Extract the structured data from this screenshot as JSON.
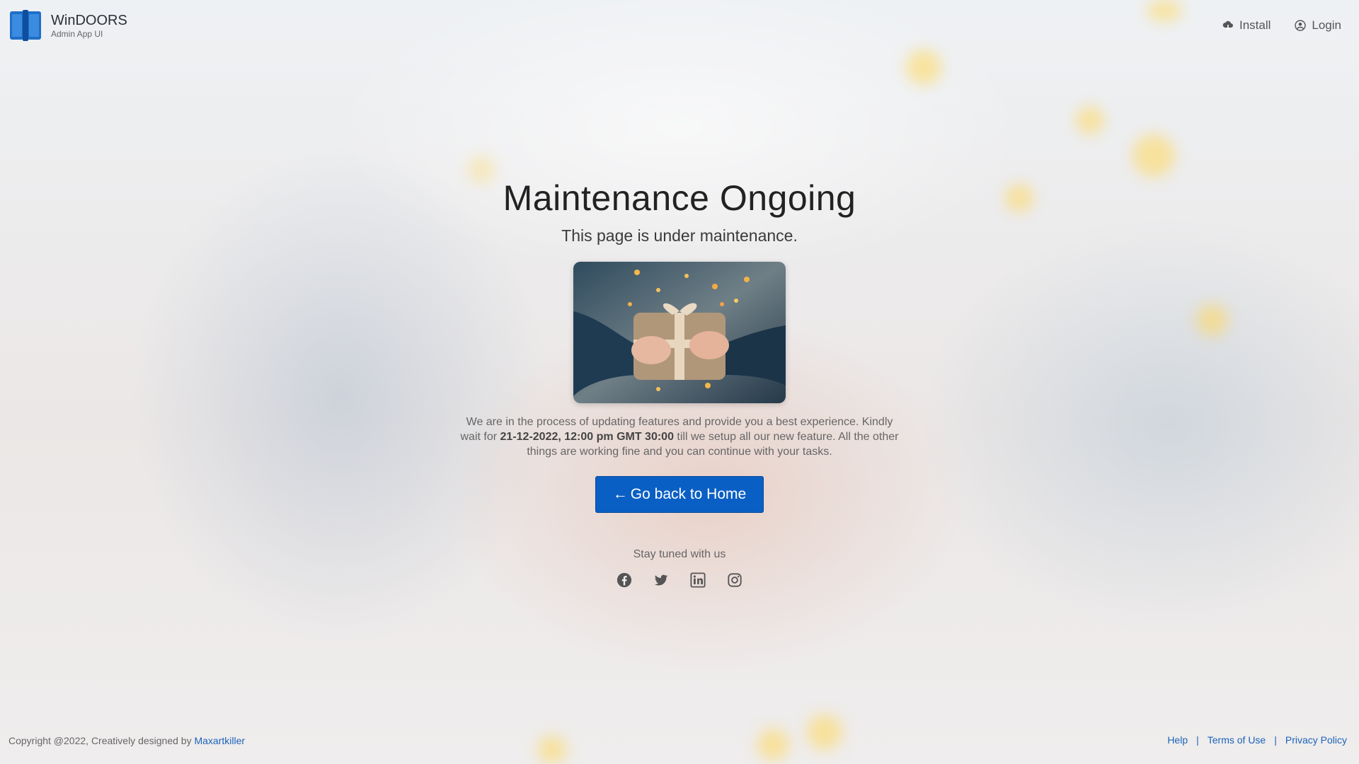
{
  "brand": {
    "name": "WinDOORS",
    "subtitle": "Admin App UI",
    "logo_icon": "book-icon",
    "logo_color": "#1e6fc7"
  },
  "nav": {
    "install": {
      "label": "Install",
      "icon": "cloud-download-icon"
    },
    "login": {
      "label": "Login",
      "icon": "user-circle-icon"
    }
  },
  "main": {
    "title": "Maintenance Ongoing",
    "subtitle": "This page is under maintenance.",
    "hero_image": "gift-box-photo",
    "description": {
      "before": "We are in the process of updating features and provide you a best experience. Kindly wait for ",
      "highlight": "21-12-2022, 12:00 pm GMT 30:00",
      "after": " till we setup all our new feature. All the other things are working fine and you can continue with your tasks."
    },
    "cta_label": "Go back to Home",
    "cta_arrow": "←",
    "cta_color": "#0a5fc4",
    "stay_tuned": "Stay tuned with us",
    "socials": [
      "facebook-icon",
      "twitter-icon",
      "linkedin-icon",
      "instagram-icon"
    ]
  },
  "footer": {
    "copyright": "Copyright @2022, Creatively designed by",
    "designer": "Maxartkiller",
    "links": [
      "Help",
      "Terms of Use",
      "Privacy Policy"
    ],
    "separator": "|",
    "link_color": "#1b63b8"
  }
}
